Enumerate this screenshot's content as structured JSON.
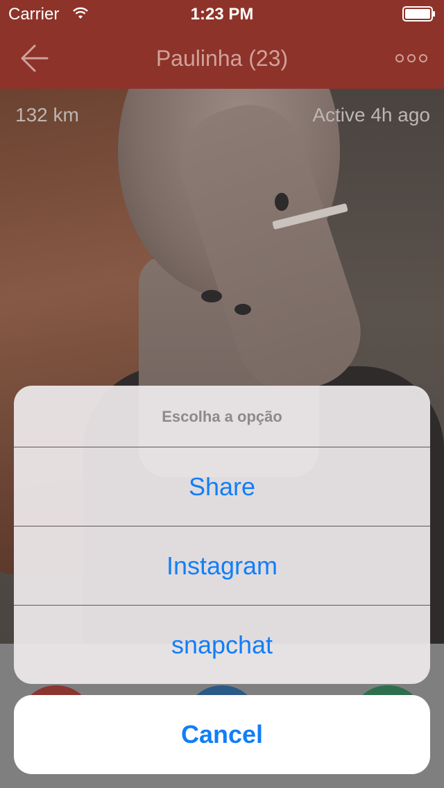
{
  "status_bar": {
    "carrier": "Carrier",
    "time": "1:23 PM",
    "wifi_icon": "wifi-icon",
    "battery_icon": "battery-icon",
    "battery_level": 1.0
  },
  "nav_bar": {
    "title": "Paulinha (23)",
    "back_icon": "arrow-left-icon",
    "more_icon": "more-dots-icon"
  },
  "profile": {
    "distance": "132 km",
    "activity": "Active 4h ago"
  },
  "action_sheet": {
    "title": "Escolha a opção",
    "options": [
      {
        "label": "Share"
      },
      {
        "label": "Instagram"
      },
      {
        "label": "snapchat"
      }
    ],
    "cancel_label": "Cancel"
  },
  "colors": {
    "nav_background": "#8e3329",
    "sheet_text": "#127ef8",
    "sheet_title": "#8c8a8c"
  }
}
